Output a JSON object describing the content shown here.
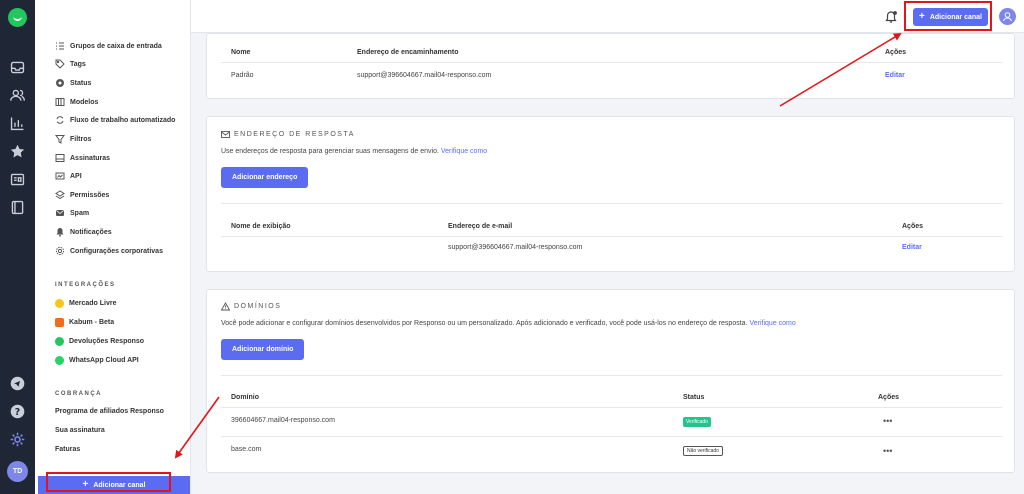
{
  "rail": {
    "avatar_initials": "TD",
    "icons": [
      "logo-icon",
      "inbox-icon",
      "contacts-icon",
      "reports-icon",
      "star-icon",
      "channels-icon",
      "notebook-icon",
      "broadcast-icon",
      "help-icon",
      "settings-icon"
    ]
  },
  "sidebar": {
    "items": [
      {
        "label": "Grupos de caixa de entrada",
        "icon": "list-icon"
      },
      {
        "label": "Tags",
        "icon": "tag-icon"
      },
      {
        "label": "Status",
        "icon": "status-icon"
      },
      {
        "label": "Modelos",
        "icon": "template-icon"
      },
      {
        "label": "Fluxo de trabalho automatizado",
        "icon": "workflow-icon"
      },
      {
        "label": "Filtros",
        "icon": "filter-icon"
      },
      {
        "label": "Assinaturas",
        "icon": "signature-icon"
      },
      {
        "label": "API",
        "icon": "api-icon"
      },
      {
        "label": "Permissões",
        "icon": "layers-icon"
      },
      {
        "label": "Spam",
        "icon": "spam-icon"
      },
      {
        "label": "Notificações",
        "icon": "bell-icon"
      },
      {
        "label": "Configurações corporativas",
        "icon": "gear-icon"
      }
    ],
    "integrations_heading": "INTEGRAÇÕES",
    "integrations": [
      {
        "label": "Mercado Livre",
        "color": "#f5c518"
      },
      {
        "label": "Kabum - Beta",
        "color": "#f26b1d"
      },
      {
        "label": "Devoluções Responso",
        "color": "#22c55e"
      },
      {
        "label": "WhatsApp Cloud API",
        "color": "#25d366"
      }
    ],
    "billing_heading": "COBRANÇA",
    "billing": [
      "Programa de afiliados Responso",
      "Sua assinatura",
      "Faturas"
    ],
    "add_channel_label": "Adicionar canal"
  },
  "topbar": {
    "add_channel_label": "Adicionar canal"
  },
  "forwarding": {
    "col_name": "Nome",
    "col_address": "Endereço de encaminhamento",
    "col_actions": "Ações",
    "rows": [
      {
        "name": "Padrão",
        "address": "support@396604667.mail04-responso.com",
        "action": "Editar"
      }
    ]
  },
  "reply": {
    "title": "ENDEREÇO DE RESPOSTA",
    "description": "Use endereços de resposta para gerenciar suas mensagens de envio.",
    "learn_more": "Verifique como",
    "add_button": "Adicionar endereço",
    "col_display": "Nome de exibição",
    "col_email": "Endereço de e-mail",
    "col_actions": "Ações",
    "rows": [
      {
        "display": "",
        "email": "support@396604667.mail04-responso.com",
        "action": "Editar"
      }
    ]
  },
  "domains": {
    "title": "DOMÍNIOS",
    "description": "Você pode adicionar e configurar domínios desenvolvidos por Responso ou um personalizado. Após adicionado e verificado, você pode usá-los no endereço de resposta.",
    "learn_more": "Verifique como",
    "add_button": "Adicionar domínio",
    "col_domain": "Domínio",
    "col_status": "Status",
    "col_actions": "Ações",
    "rows": [
      {
        "domain": "396604667.mail04-responso.com",
        "status": "Verificado",
        "actions": "•••"
      },
      {
        "domain": "base.com",
        "status": "Não verificado",
        "actions": "•••"
      }
    ]
  },
  "colors": {
    "accent": "#5b6cf2",
    "rail_bg": "#1f2736",
    "verified": "#22c58b",
    "annotation": "#e3151a"
  }
}
